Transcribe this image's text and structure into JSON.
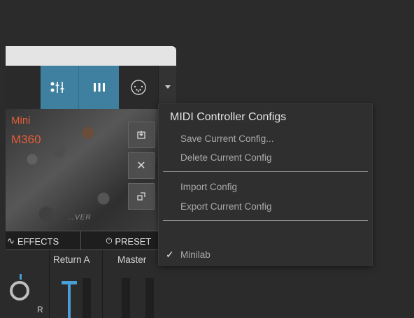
{
  "plugin": {
    "brand_line1": "Mini",
    "brand_line2": "M360",
    "watermark": "…VER"
  },
  "toolbar": {
    "buttons": [
      {
        "icon": "mixer-sliders-icon"
      },
      {
        "icon": "keyboard-keys-icon"
      },
      {
        "icon": "midi-port-icon"
      },
      {
        "icon": "dropdown-arrow-icon"
      }
    ]
  },
  "side_buttons": [
    {
      "icon": "save-disk-icon"
    },
    {
      "icon": "close-icon",
      "glyph": "✕"
    },
    {
      "icon": "expand-icon"
    }
  ],
  "tabs": [
    {
      "label": "EFFECTS",
      "icon": "wave-icon",
      "glyph": "∿"
    },
    {
      "label": "PRESET",
      "icon": "power-icon",
      "glyph": "⏻"
    }
  ],
  "mixer": {
    "channels": [
      {
        "label": "Return A"
      },
      {
        "label": "Master"
      }
    ],
    "knob_label": "R"
  },
  "midi_menu": {
    "title": "MIDI Controller Configs",
    "actions": [
      "Save Current Config...",
      "Delete Current Config",
      "Import Config",
      "Export Current Config"
    ],
    "configs": [
      {
        "label": "Minilab",
        "checked": true,
        "check_glyph": "✓"
      }
    ]
  },
  "colors": {
    "accent": "#3f7fa0",
    "brand": "#e45d3a",
    "fader": "#4a9ed6",
    "menu_bg": "#2f2f2f"
  }
}
